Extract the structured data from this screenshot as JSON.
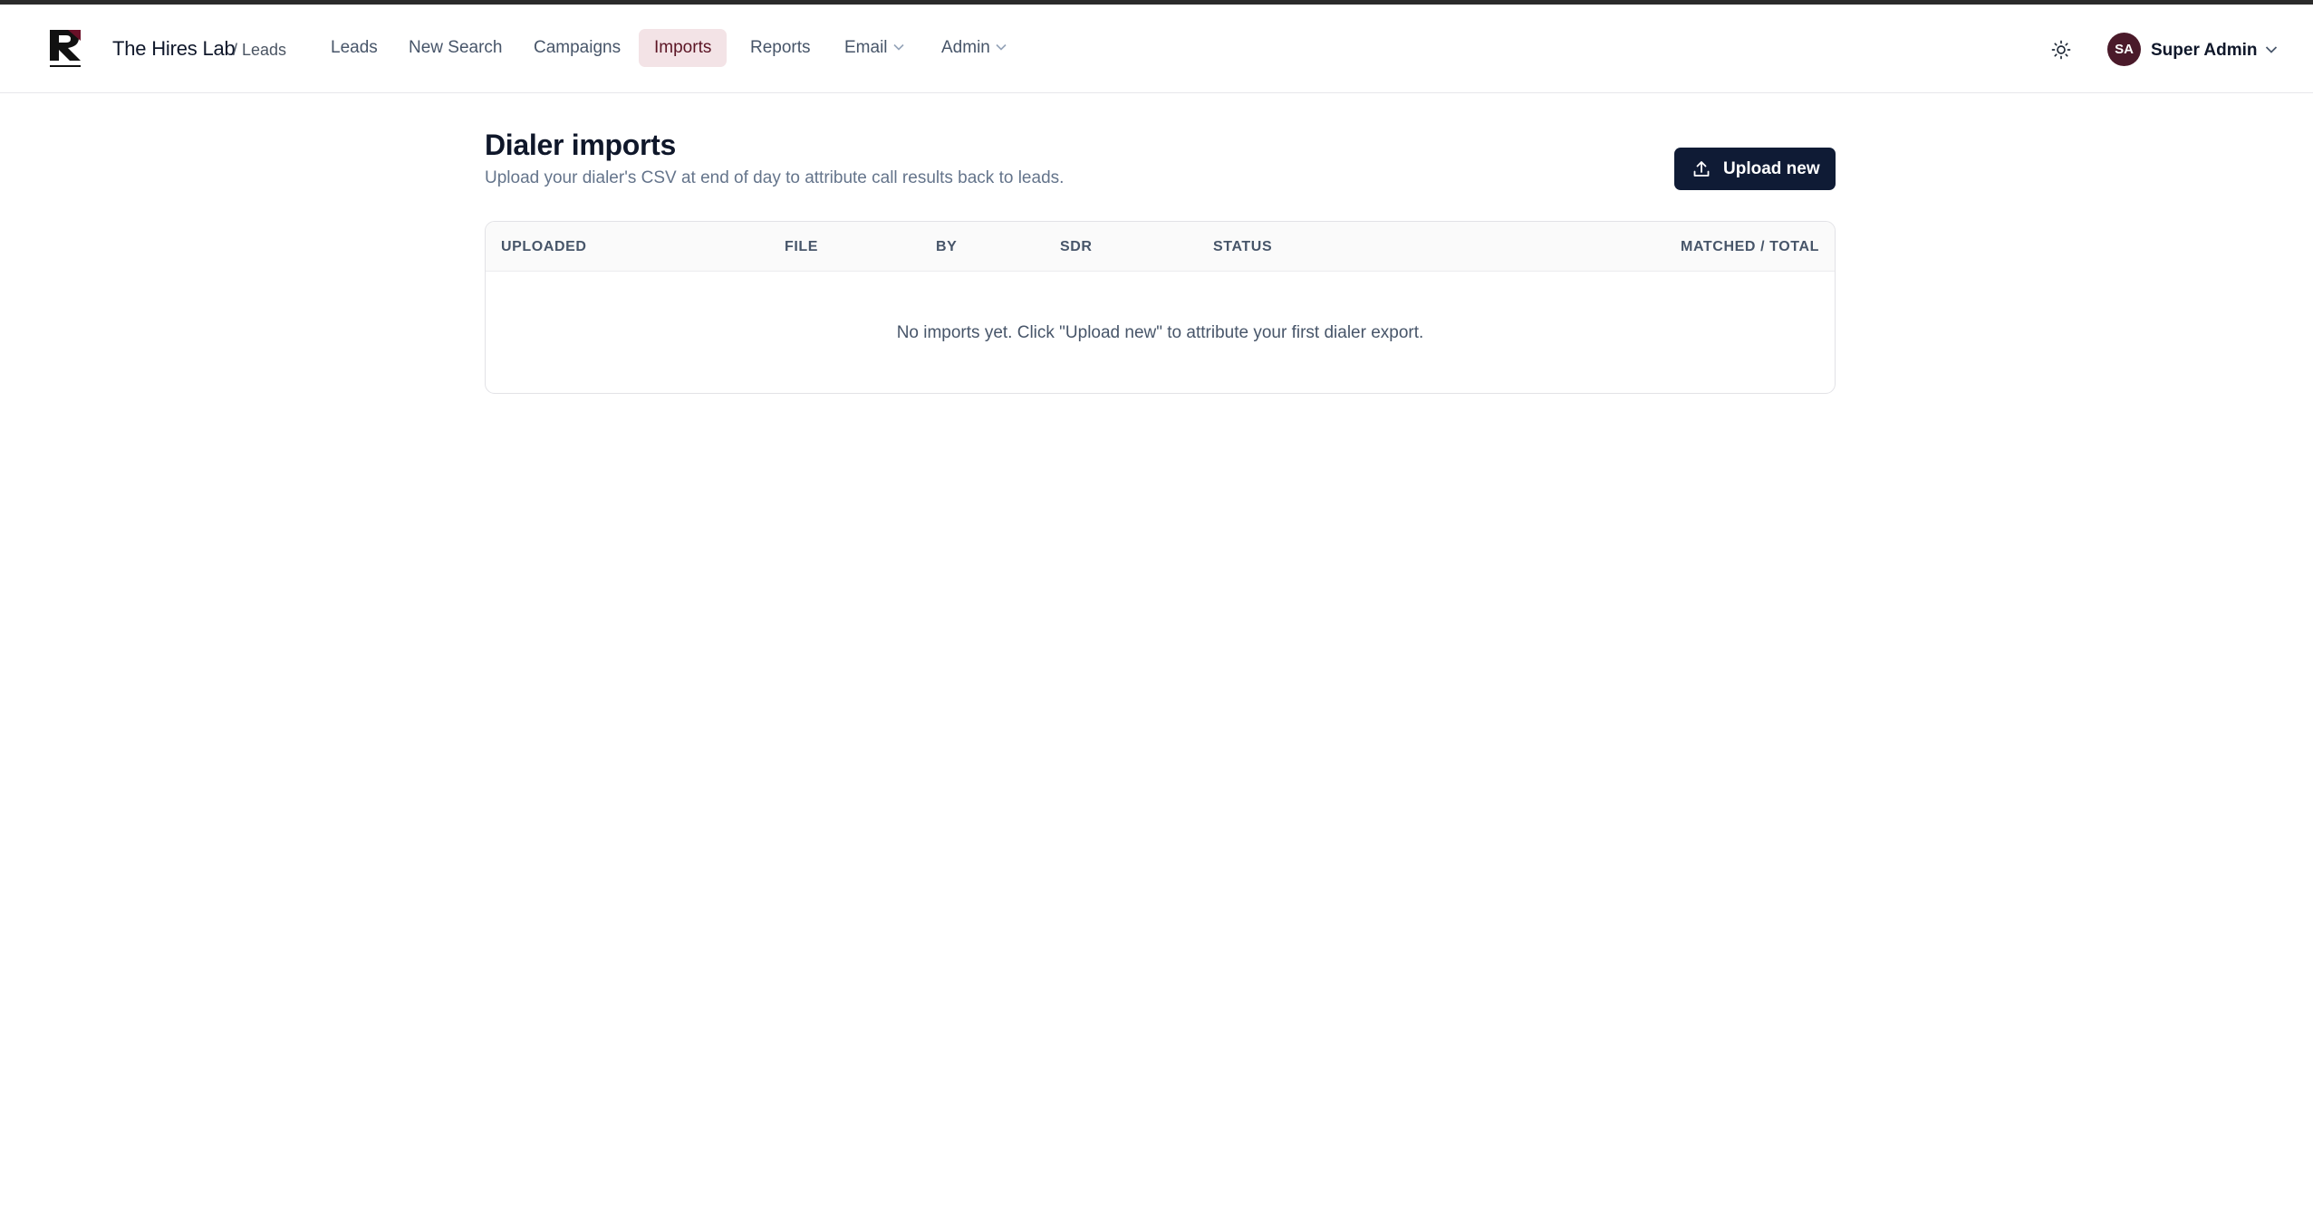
{
  "app": {
    "brand": "The Hires Lab",
    "brand_sub": "/ Leads"
  },
  "nav": {
    "items": [
      {
        "label": "Leads",
        "active": false
      },
      {
        "label": "New Search",
        "active": false
      },
      {
        "label": "Campaigns",
        "active": false
      },
      {
        "label": "Imports",
        "active": true
      },
      {
        "label": "Reports",
        "active": false
      },
      {
        "label": "Email",
        "active": false,
        "dropdown": true
      },
      {
        "label": "Admin",
        "active": false,
        "dropdown": true
      }
    ]
  },
  "user": {
    "initials": "SA",
    "name": "Super Admin"
  },
  "page": {
    "title": "Dialer imports",
    "description": "Upload your dialer's CSV at end of day to attribute call results back to leads.",
    "upload_label": "Upload new"
  },
  "table": {
    "columns": [
      "UPLOADED",
      "FILE",
      "BY",
      "SDR",
      "STATUS",
      "MATCHED / TOTAL"
    ],
    "empty_message": "No imports yet. Click \"Upload new\" to attribute your first dialer export."
  },
  "icons": {
    "theme": "sun-icon",
    "upload": "upload-icon",
    "chevron": "chevron-down-icon"
  },
  "colors": {
    "accent": "#5b1424",
    "accent_bg": "#f3e3e6",
    "primary_button": "#0f1b35",
    "avatar": "#4a1a2a"
  }
}
